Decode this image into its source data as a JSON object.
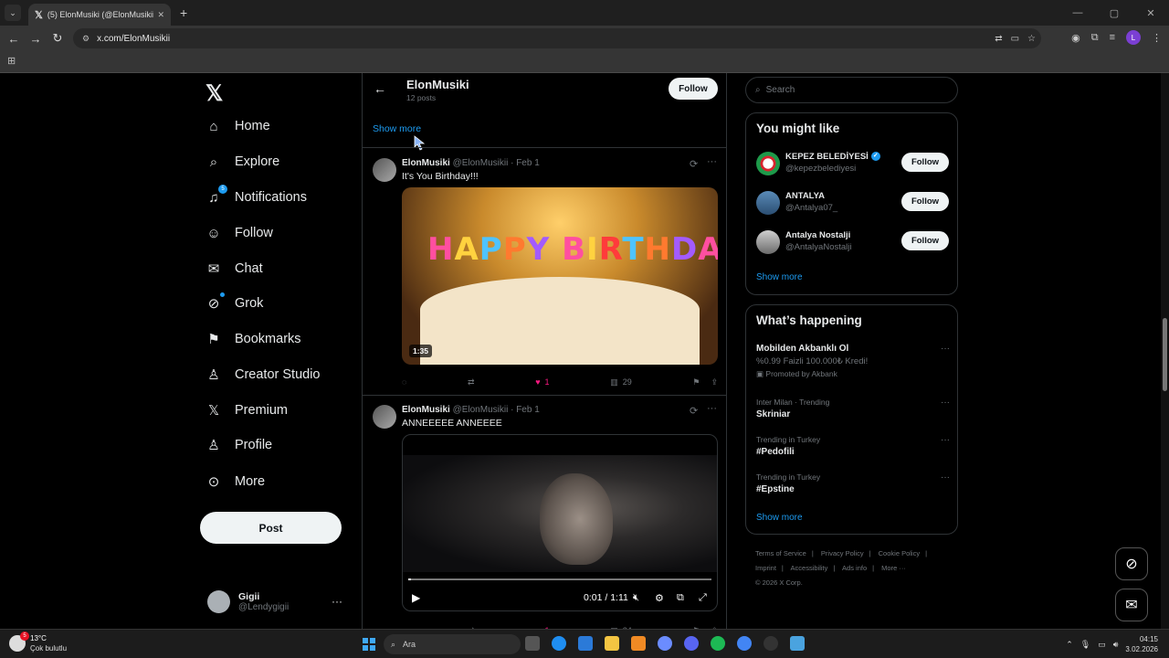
{
  "browser": {
    "tab_title": "(5) ElonMusiki (@ElonMusikii) /",
    "url": "x.com/ElonMusikii",
    "profile_letter": "L"
  },
  "nav": {
    "items": [
      {
        "label": "Home",
        "icon": "home-icon"
      },
      {
        "label": "Explore",
        "icon": "search-icon"
      },
      {
        "label": "Notifications",
        "icon": "bell-icon",
        "badge": "5"
      },
      {
        "label": "Follow",
        "icon": "add-person-icon"
      },
      {
        "label": "Chat",
        "icon": "envelope-icon"
      },
      {
        "label": "Grok",
        "icon": "grok-icon"
      },
      {
        "label": "Bookmarks",
        "icon": "bookmark-icon"
      },
      {
        "label": "Creator Studio",
        "icon": "creator-icon"
      },
      {
        "label": "Premium",
        "icon": "x-icon"
      },
      {
        "label": "Profile",
        "icon": "person-icon"
      },
      {
        "label": "More",
        "icon": "more-circle-icon"
      }
    ],
    "post_label": "Post",
    "account": {
      "name": "Gigii",
      "handle": "@Lendygigii"
    }
  },
  "profile_header": {
    "name": "ElonMusiki",
    "count": "12 posts",
    "follow_label": "Follow"
  },
  "show_more_label": "Show more",
  "tweets": [
    {
      "name": "ElonMusiki",
      "meta": "@ElonMusikii · Feb 1",
      "text": "It's You Birthday!!!",
      "media_text": "HAPPY BIRTHDAY",
      "duration": "1:35",
      "likes": "1",
      "views": "29"
    },
    {
      "name": "ElonMusiki",
      "meta": "@ElonMusikii · Feb 1",
      "text": "ANNEEEEE ANNEEEE",
      "video_time": "0:01 / 1:11",
      "video_progress": 0.01,
      "likes": "1",
      "views": "24"
    }
  ],
  "sidebar": {
    "search_placeholder": "Search",
    "you_might_like": {
      "title": "You might like",
      "accounts": [
        {
          "name": "KEPEZ BELEDİYESİ",
          "handle": "@kepezbelediyesi",
          "verified": true,
          "follow": "Follow"
        },
        {
          "name": "ANTALYA",
          "handle": "@Antalya07_",
          "follow": "Follow"
        },
        {
          "name": "Antalya Nostalji",
          "handle": "@AntalyaNostalji",
          "follow": "Follow"
        }
      ],
      "show_more": "Show more"
    },
    "whats_happening": {
      "title": "What’s happening",
      "trends": [
        {
          "context": "",
          "title": "Mobilden Akbanklı Ol",
          "subtitle": "%0.99 Faizli 100.000₺ Kredi!",
          "promo": "Promoted by Akbank"
        },
        {
          "context": "Inter Milan · Trending",
          "title": "Skriniar"
        },
        {
          "context": "Trending in Turkey",
          "title": "#Pedofili"
        },
        {
          "context": "Trending in Turkey",
          "title": "#Epstine"
        }
      ],
      "show_more": "Show more"
    },
    "footer": {
      "links": [
        "Terms of Service",
        "|",
        "Privacy Policy",
        "|",
        "Cookie Policy",
        "|",
        "Imprint",
        "|",
        "Accessibility",
        "|",
        "Ads info",
        "|",
        "More ···"
      ],
      "copyright": "© 2026 X Corp."
    }
  },
  "taskbar": {
    "weather_temp": "13°C",
    "weather_desc": "Çok bulutlu",
    "weather_badge": "5",
    "search": "Ara",
    "time": "04:15",
    "date": "3.02.2026"
  }
}
